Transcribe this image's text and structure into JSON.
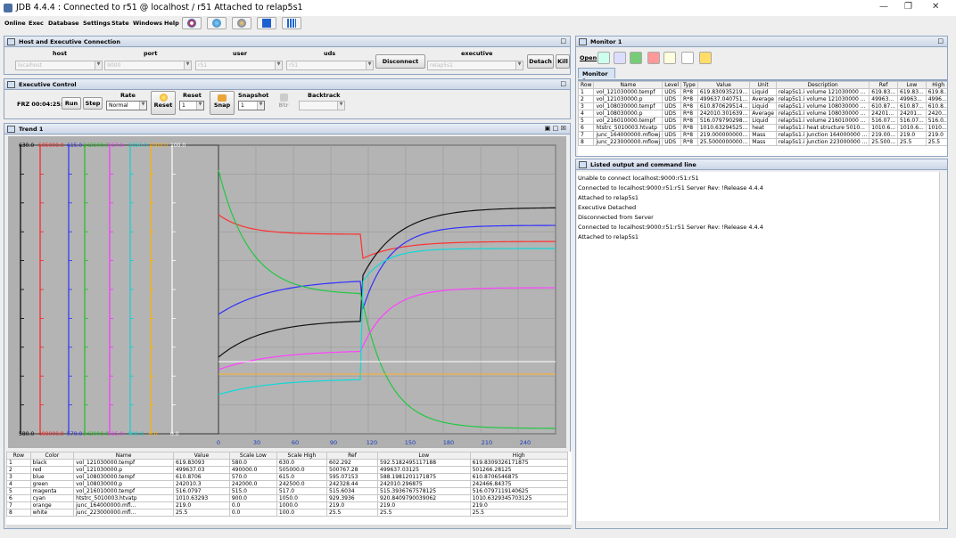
{
  "window": {
    "title": "JDB 4.4.4 :  Connected to r51 @ localhost / r51   Attached to relap5s1"
  },
  "menu": [
    "Online",
    "Exec",
    "Database",
    "Settings",
    "State",
    "Windows",
    "Help"
  ],
  "host_panel": {
    "title": "Host and Executive Connection",
    "labels": {
      "host": "host",
      "port": "port",
      "user": "user",
      "uds": "uds",
      "executive": "executive"
    },
    "values": {
      "host": "localhost",
      "port": "9000",
      "user": "r51",
      "uds": "r51",
      "executive": "relap5s1"
    },
    "disconnect": "Disconnect",
    "detach": "Detach",
    "kill": "Kill"
  },
  "exec_panel": {
    "title": "Executive Control",
    "status": "FRZ  00:04:25:06",
    "run": "Run",
    "step": "Step",
    "rate_label": "Rate",
    "rate_value": "Normal",
    "reset_label": "Reset",
    "reset_btn": "Reset",
    "reset_value": "1",
    "snapshot_label": "Snapshot",
    "snap_btn": "Snap",
    "snap_value": "1",
    "backtrack_label": "Backtrack",
    "btr_btn": "Btr"
  },
  "trend": {
    "title": "Trend 1",
    "top_scale": [
      "630.0",
      "505000.0",
      "615.0",
      "242500.0",
      "517.0",
      "1050.0",
      "1000.0",
      "100.0"
    ],
    "bottom_scale": [
      "580.0",
      "490000.0",
      "570.0",
      "242000.0",
      "515.0",
      "900.0",
      "0.0",
      "0.0"
    ],
    "scale_colors": [
      "#000000",
      "#ff2020",
      "#3030ff",
      "#20c020",
      "#ff30ff",
      "#10d0d0",
      "#ffb000",
      "#ffffff"
    ],
    "x_ticks": [
      "0",
      "30",
      "60",
      "90",
      "120",
      "150",
      "180",
      "210",
      "240"
    ]
  },
  "trend_table": {
    "headers": [
      "Row",
      "Color",
      "Name",
      "Value",
      "Scale Low",
      "Scale High",
      "Ref",
      "Low",
      "High"
    ],
    "rows": [
      [
        "1",
        "black",
        "vol_121030000.tempf",
        "619.83093",
        "580.0",
        "630.0",
        "602.292",
        "592.5182495117188",
        "619.8309326171875"
      ],
      [
        "2",
        "red",
        "vol_121030000.p",
        "499637.03",
        "490000.0",
        "505000.0",
        "500767.28",
        "499637.03125",
        "501266.28125"
      ],
      [
        "3",
        "blue",
        "vol_108030000.tempf",
        "610.8706",
        "570.0",
        "615.0",
        "595.07153",
        "588.1981201171875",
        "610.8706546875"
      ],
      [
        "4",
        "green",
        "vol_108030000.p",
        "242010.3",
        "242000.0",
        "242500.0",
        "242328.44",
        "242010.296875",
        "242466.84375"
      ],
      [
        "5",
        "magenta",
        "vol_216010000.tempf",
        "516.0797",
        "515.0",
        "517.0",
        "515.6034",
        "515.3936767578125",
        "516.0797119140625"
      ],
      [
        "6",
        "cyan",
        "htstrc_5010003.htvatp",
        "1010.63293",
        "900.0",
        "1050.0",
        "929.3936",
        "920.8409790039062",
        "1010.6329345703125"
      ],
      [
        "7",
        "orange",
        "junc_164000000.mfl...",
        "219.0",
        "0.0",
        "1000.0",
        "219.0",
        "219.0",
        "219.0"
      ],
      [
        "8",
        "white",
        "junc_223000000.mfl...",
        "25.5",
        "0.0",
        "100.0",
        "25.5",
        "25.5",
        "25.5"
      ]
    ]
  },
  "monitor": {
    "title": "Monitor 1",
    "open": "Open",
    "tab": "Monitor 1",
    "headers": [
      "Row",
      "Name",
      "Level",
      "Type",
      "Value",
      "Unit",
      "Description",
      "Ref",
      "Low",
      "High"
    ],
    "rows": [
      [
        "1",
        "vol_121030000.tempf",
        "UDS",
        "R*8",
        "619.830935219...",
        "Liquid",
        "relap5s1.i volume 121030000 ...",
        "619.83...",
        "619.83...",
        "619.8..."
      ],
      [
        "2",
        "vol_121030000.p",
        "UDS",
        "R*8",
        "499637.040751...",
        "Average",
        "relap5s1.i volume 121030000 ...",
        "49963...",
        "49963...",
        "4996..."
      ],
      [
        "3",
        "vol_108030000.tempf",
        "UDS",
        "R*8",
        "610.870629514...",
        "Liquid",
        "relap5s1.i volume 108030000 ...",
        "610.87...",
        "610.87...",
        "610.8..."
      ],
      [
        "4",
        "vol_108030000.p",
        "UDS",
        "R*8",
        "242010.301639...",
        "Average",
        "relap5s1.i volume 108030000 ...",
        "24201...",
        "24201...",
        "2420..."
      ],
      [
        "5",
        "vol_216010000.tempf",
        "UDS",
        "R*8",
        "516.079790298...",
        "Liquid",
        "relap5s1.i volume 216010000 ...",
        "516.07...",
        "516.07...",
        "516.0..."
      ],
      [
        "6",
        "htstrc_5010003.htvatp",
        "UDS",
        "R*8",
        "1010.63294525...",
        "heat",
        "relap5s1.i heat structure 5010...",
        "1010.6...",
        "1010.6...",
        "1010..."
      ],
      [
        "7",
        "junc_164000000.mflowj",
        "UDS",
        "R*8",
        "219.000000000...",
        "Mass",
        "relap5s1.i junction 164000000 ...",
        "219.00...",
        "219.0",
        "219.0"
      ],
      [
        "8",
        "junc_223000000.mflowj",
        "UDS",
        "R*8",
        "25.5000000000...",
        "Mass",
        "relap5s1.i junction 223000000 ...",
        "25.500...",
        "25.5",
        "25.5"
      ]
    ]
  },
  "log": {
    "title": "Listed output and command line",
    "lines": [
      "Unable to connect localhost:9000:r51:r51",
      "Connected to localhost:9000:r51:r51 Server Rev: !Release 4.4.4",
      " Attached to relap5s1",
      " Executive Detached",
      "Disconnected from Server",
      "Connected to localhost:9000:r51:r51 Server Rev: !Release 4.4.4",
      " Attached to relap5s1"
    ]
  }
}
